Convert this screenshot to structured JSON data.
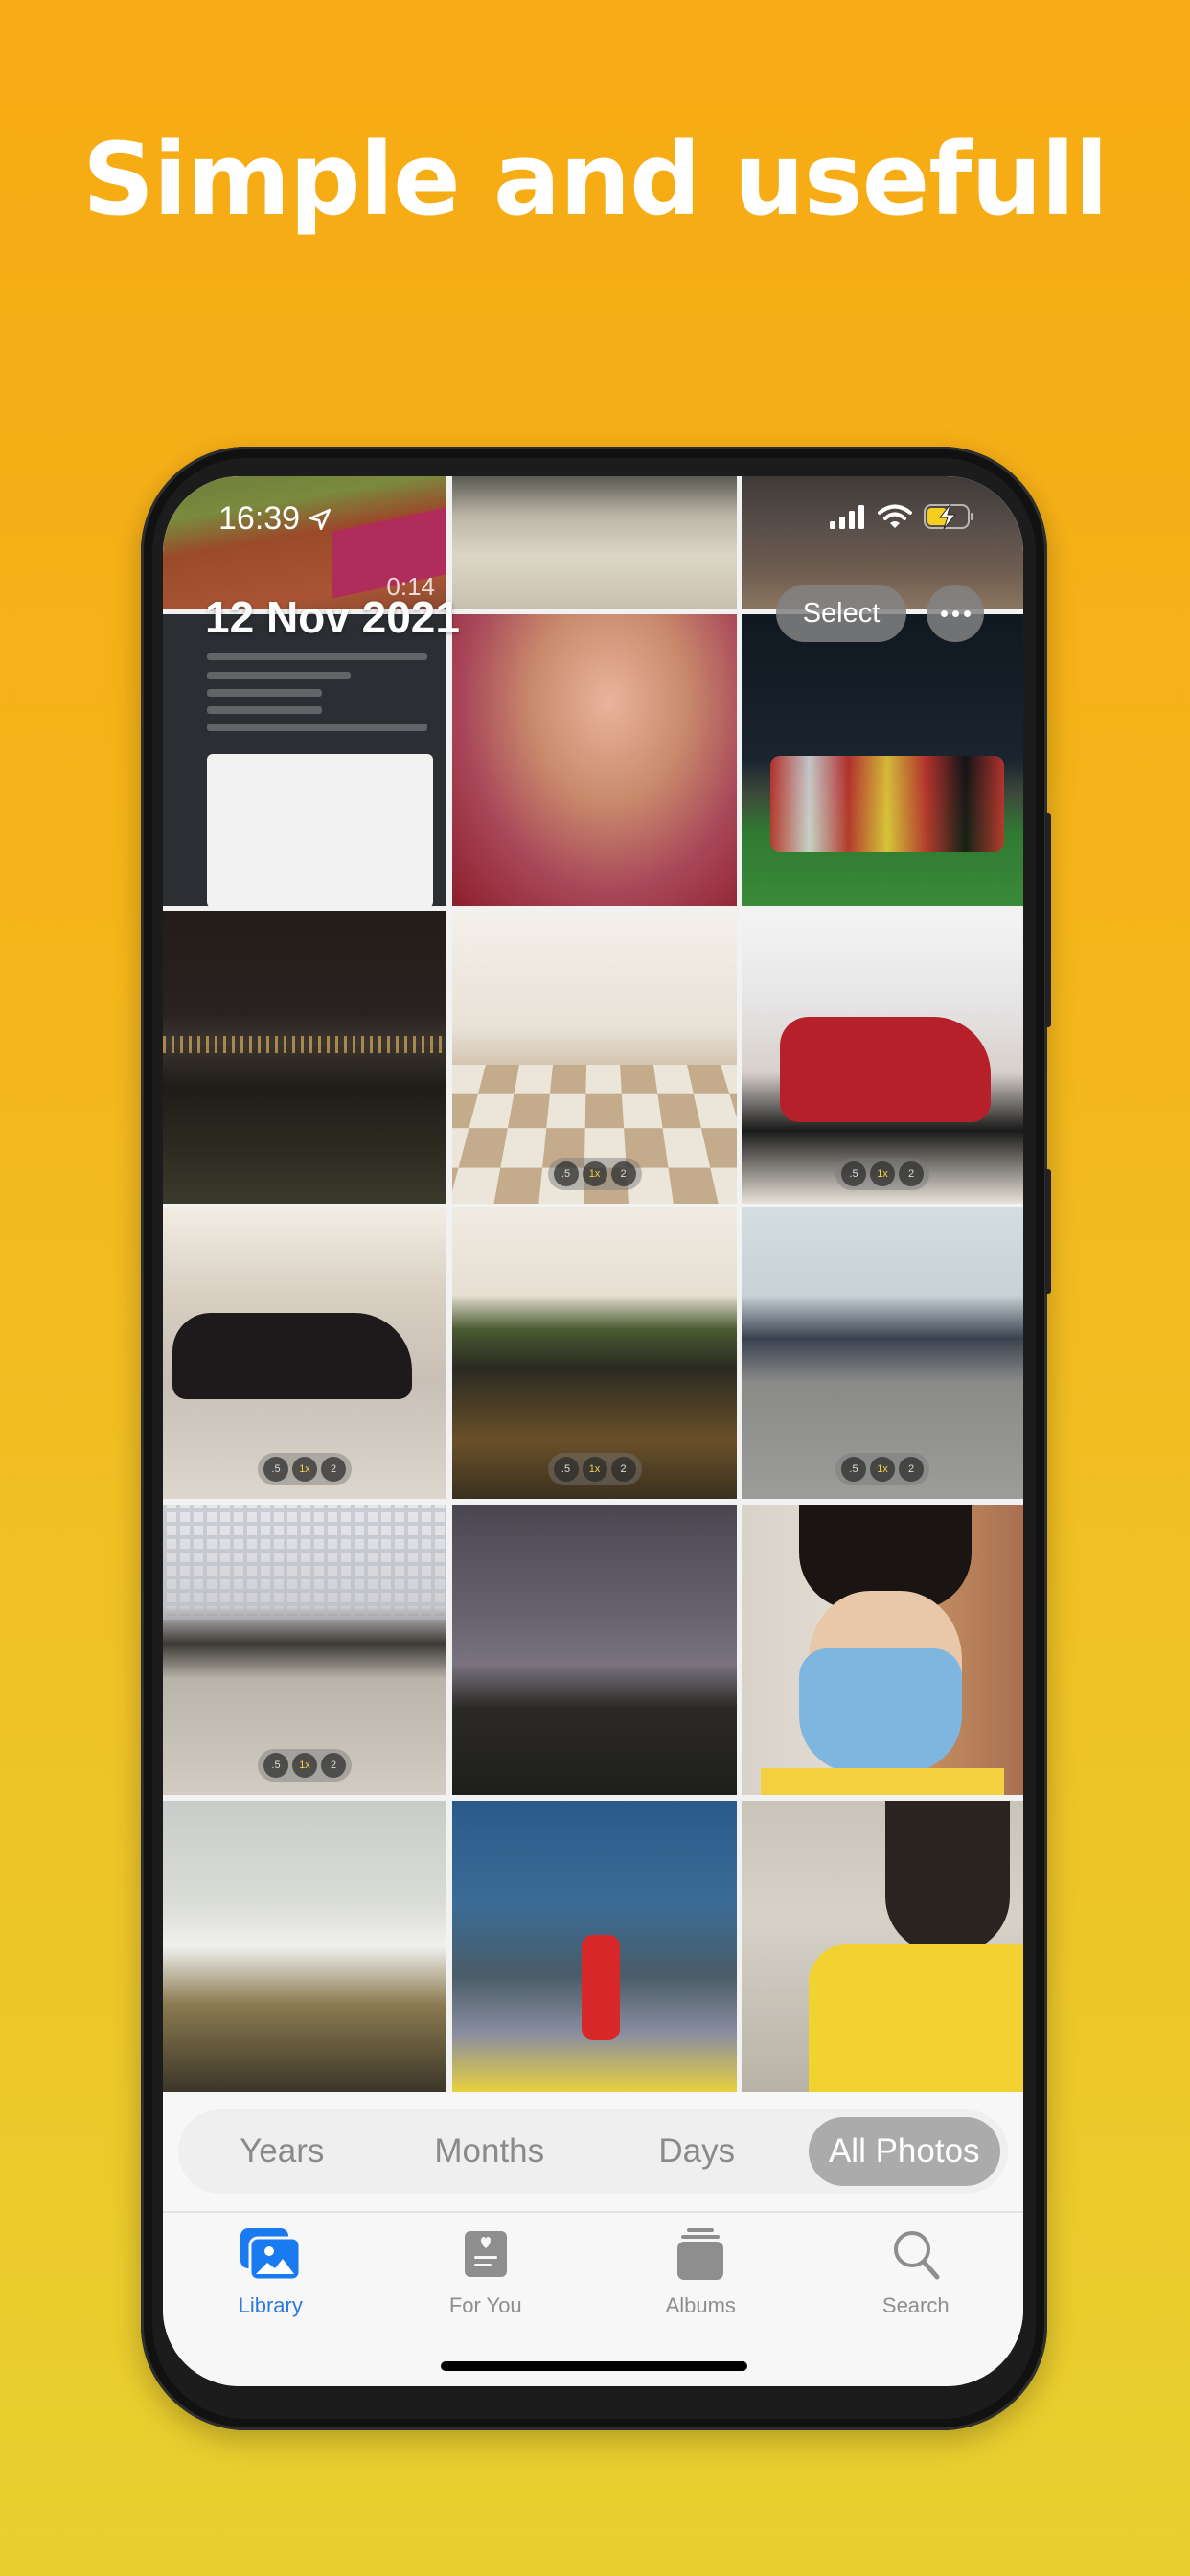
{
  "headline": "Simple and usefull",
  "status_bar": {
    "time": "16:39",
    "location_icon": "location-arrow-icon",
    "signal_icon": "cellular-signal-icon",
    "wifi_icon": "wifi-icon",
    "battery_icon": "battery-charging-icon"
  },
  "library": {
    "date_title": "12 Nov 2021",
    "select_label": "Select",
    "more_icon": "ellipsis-icon",
    "video_duration": "0:14",
    "camera_zoom_labels": [
      ".5",
      "1x",
      "2"
    ],
    "photos": [
      {
        "row": 0,
        "subject": "stadium video"
      },
      {
        "row": 0,
        "subject": "kids collage"
      },
      {
        "row": 0,
        "subject": "classroom collage"
      },
      {
        "row": 1,
        "subject": "chat screenshot"
      },
      {
        "row": 1,
        "subject": "selfie red shirt"
      },
      {
        "row": 1,
        "subject": "football team night"
      },
      {
        "row": 2,
        "subject": "city at night"
      },
      {
        "row": 2,
        "subject": "mall corridor"
      },
      {
        "row": 2,
        "subject": "red car showroom"
      },
      {
        "row": 3,
        "subject": "black car mall"
      },
      {
        "row": 3,
        "subject": "koi pond"
      },
      {
        "row": 3,
        "subject": "horse statues"
      },
      {
        "row": 4,
        "subject": "palace plaza"
      },
      {
        "row": 4,
        "subject": "city skyline dusk"
      },
      {
        "row": 4,
        "subject": "masked selfie"
      },
      {
        "row": 5,
        "subject": "street buildings"
      },
      {
        "row": 5,
        "subject": "christmas arch"
      },
      {
        "row": 5,
        "subject": "girl with glasses"
      }
    ]
  },
  "segment": {
    "items": [
      "Years",
      "Months",
      "Days",
      "All Photos"
    ],
    "selected": "All Photos"
  },
  "tab_bar": {
    "items": [
      {
        "label": "Library",
        "icon": "photo-library-icon",
        "active": true
      },
      {
        "label": "For You",
        "icon": "for-you-icon",
        "active": false
      },
      {
        "label": "Albums",
        "icon": "albums-icon",
        "active": false
      },
      {
        "label": "Search",
        "icon": "search-icon",
        "active": false
      }
    ]
  },
  "colors": {
    "accent": "#2A7AE2",
    "background_top": "#F7AA13",
    "background_bottom": "#E9D030",
    "battery": "#F5CE1E"
  }
}
